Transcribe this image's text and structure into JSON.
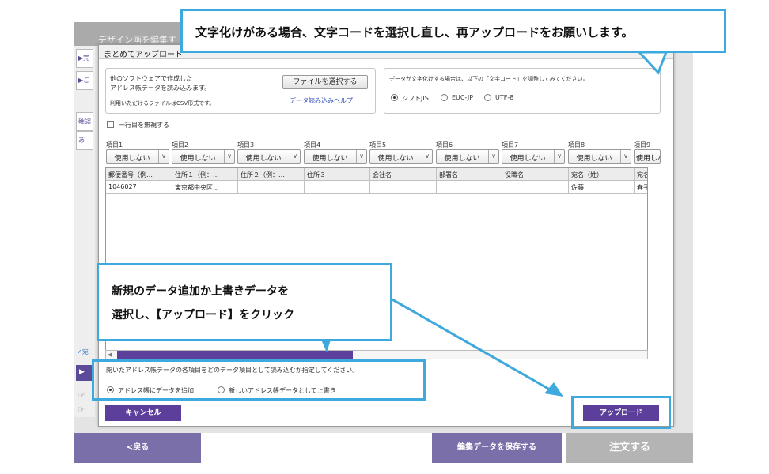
{
  "background": {
    "topbar_label": "デザイン画を編集す",
    "side_tabs": [
      "▶完",
      "▶ご",
      "確認",
      "あ"
    ],
    "side_check": "✓宛",
    "side_purple": "▶",
    "buttons": {
      "back": "<戻る",
      "save": "編集データを保存する",
      "order": "注文する"
    }
  },
  "dialog": {
    "title": "まとめてアップロード",
    "file_info": {
      "line1": "他のソフトウェアで作成した",
      "line2": "アドレス帳データを読み込みます。",
      "line3": "利用いただけるファイルはCSV形式です。",
      "select_button": "ファイルを選択する",
      "help_link": "データ読み込みヘルプ"
    },
    "encoding": {
      "note": "データが文字化けする場合は、以下の「文字コード」を調整してみてください。",
      "options": [
        "シフトJIS",
        "EUC-JP",
        "UTF-8"
      ],
      "selected": "シフトJIS"
    },
    "ignore_first_row": "一行目を無視する",
    "columns": {
      "headers": [
        "項目1",
        "項目2",
        "項目3",
        "項目4",
        "項目5",
        "項目6",
        "項目7",
        "項目8",
        "項目9"
      ],
      "select_value": "使用しない"
    },
    "table": {
      "header": [
        "郵便番号（例…",
        "住所１（例：…",
        "住所２（例：…",
        "住所３",
        "会社名",
        "部署名",
        "役職名",
        "宛名（姓）",
        "宛名（"
      ],
      "rows": [
        [
          "1046027",
          "東京都中央区…",
          "",
          "",
          "",
          "",
          "",
          "佐藤",
          "春子"
        ]
      ]
    },
    "mode": {
      "question": "開いたアドレス帳データの各項目をどのデータ項目として読み込むか指定してください。",
      "options": [
        "アドレス帳にデータを追加",
        "新しいアドレス帳データとして上書き"
      ],
      "selected": "アドレス帳にデータを追加"
    },
    "cancel_button": "キャンセル",
    "upload_button": "アップロード"
  },
  "annotations": {
    "top_callout": "文字化けがある場合、文字コードを選択し直し、再アップロードをお願いします。",
    "mid_callout_line1": "新規のデータ追加か上書きデータを",
    "mid_callout_line2": "選択し、【アップロード】をクリック",
    "accent_color": "#3ea9dc",
    "brand_color": "#5b3f9a"
  }
}
